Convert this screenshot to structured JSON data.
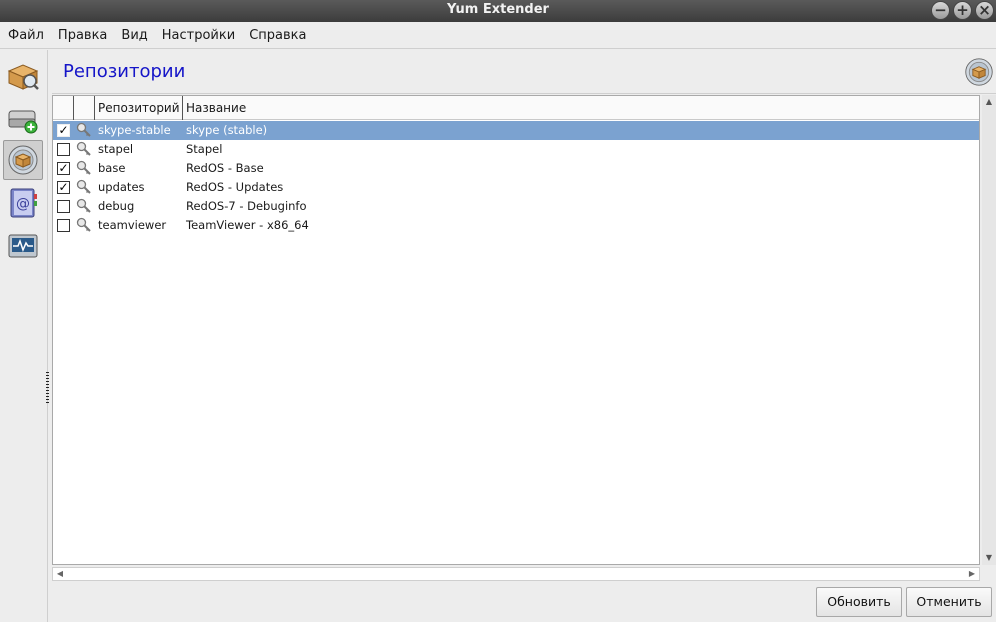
{
  "window": {
    "title": "Yum Extender",
    "controls": [
      "minimize-icon",
      "maximize-icon",
      "close-icon"
    ]
  },
  "menu": [
    "Файл",
    "Правка",
    "Вид",
    "Настройки",
    "Справка"
  ],
  "sidebar": {
    "items": [
      {
        "icon": "packages-icon"
      },
      {
        "icon": "add-drive-icon"
      },
      {
        "icon": "repositories-icon",
        "active": true
      },
      {
        "icon": "history-book-icon"
      },
      {
        "icon": "monitor-icon"
      }
    ]
  },
  "page": {
    "title": "Репозитории",
    "title_color": "#1515c8"
  },
  "table": {
    "columns": [
      "Репозиторий",
      "Название"
    ],
    "rows": [
      {
        "checked": true,
        "id": "skype-stable",
        "name": "skype (stable)",
        "selected": true
      },
      {
        "checked": false,
        "id": "stapel",
        "name": "Stapel"
      },
      {
        "checked": true,
        "id": "base",
        "name": "RedOS - Base"
      },
      {
        "checked": true,
        "id": "updates",
        "name": "RedOS - Updates"
      },
      {
        "checked": false,
        "id": "debug",
        "name": "RedOS-7 - Debuginfo"
      },
      {
        "checked": false,
        "id": "teamviewer",
        "name": "TeamViewer - x86_64"
      }
    ],
    "selection_color": "#7ba2d0"
  },
  "buttons": {
    "refresh": "Обновить",
    "cancel": "Отменить"
  }
}
